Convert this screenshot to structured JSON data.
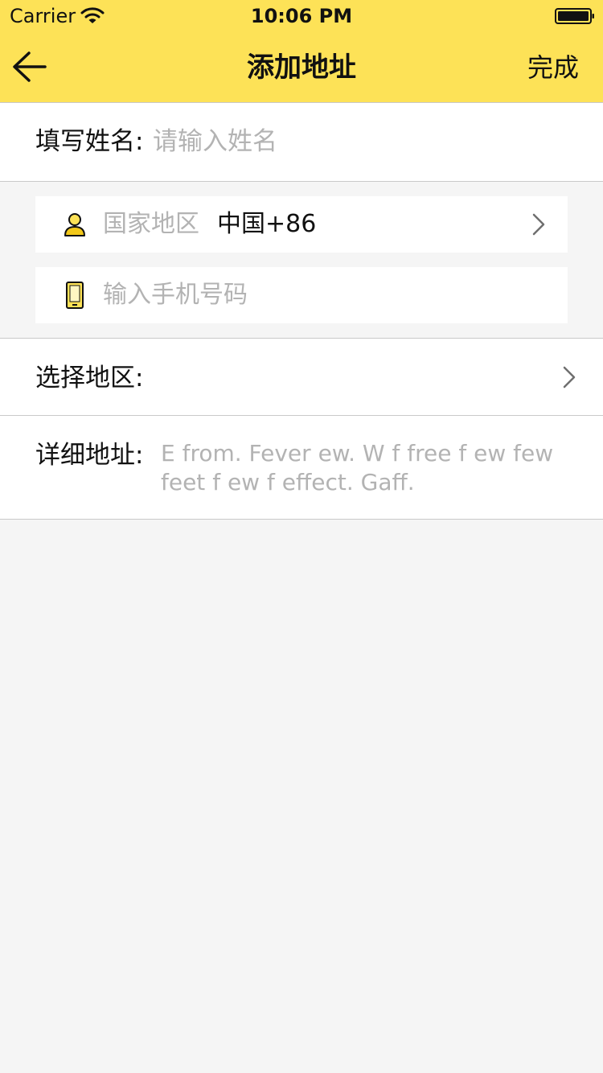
{
  "status_bar": {
    "carrier": "Carrier",
    "time": "10:06 PM"
  },
  "nav": {
    "title": "添加地址",
    "done_label": "完成"
  },
  "name_field": {
    "label": "填写姓名:",
    "placeholder": "请输入姓名"
  },
  "country_field": {
    "label": "国家地区",
    "value": "中国+86"
  },
  "phone_field": {
    "placeholder": "输入手机号码"
  },
  "region_field": {
    "label": "选择地区:"
  },
  "detail_field": {
    "label": "详细地址:",
    "value": "E from. Fever ew. W f free f ew few feet f ew f effect.   Gaff."
  },
  "colors": {
    "accent": "#fde257",
    "background": "#f5f5f5",
    "placeholder": "#b3b3b3"
  }
}
